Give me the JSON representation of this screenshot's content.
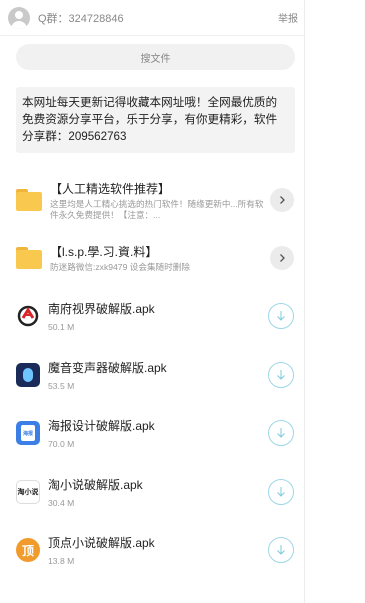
{
  "header": {
    "qq_group": "Q群：324728846",
    "report_label": "举报"
  },
  "search": {
    "button_label": "搜文件"
  },
  "notice": {
    "text": "本网址每天更新记得收藏本网址哦！全网最优质的免费资源分享平台，乐于分享，有你更精彩，软件分享群：209562763"
  },
  "folders": [
    {
      "title": "【人工精选软件推荐】",
      "desc": "这里均是人工精心挑选的热门软件！随缘更新中...所有软件永久免费提供！【注意：..."
    },
    {
      "title": "【l.s.p.學.习.資.料】",
      "desc": "防迷路微信:zxk9479 设会集随时删除"
    }
  ],
  "files": [
    {
      "name": "南府视界破解版.apk",
      "size": "50.1 M",
      "icon": "app-logo-icon"
    },
    {
      "name": "魔音变声器破解版.apk",
      "size": "53.5 M",
      "icon": "microphone-icon"
    },
    {
      "name": "海报设计破解版.apk",
      "size": "70.0 M",
      "icon": "poster-icon",
      "icon_text": "海报"
    },
    {
      "name": "淘小说破解版.apk",
      "size": "30.4 M",
      "icon": "novel-icon",
      "icon_text": "淘小说"
    },
    {
      "name": "顶点小说破解版.apk",
      "size": "13.8 M",
      "icon": "novel-icon",
      "icon_text": "顶"
    }
  ],
  "colors": {
    "folder": "#f9c84f",
    "download_ring": "#9fd7e6",
    "arrow_bg": "#ebebeb"
  }
}
